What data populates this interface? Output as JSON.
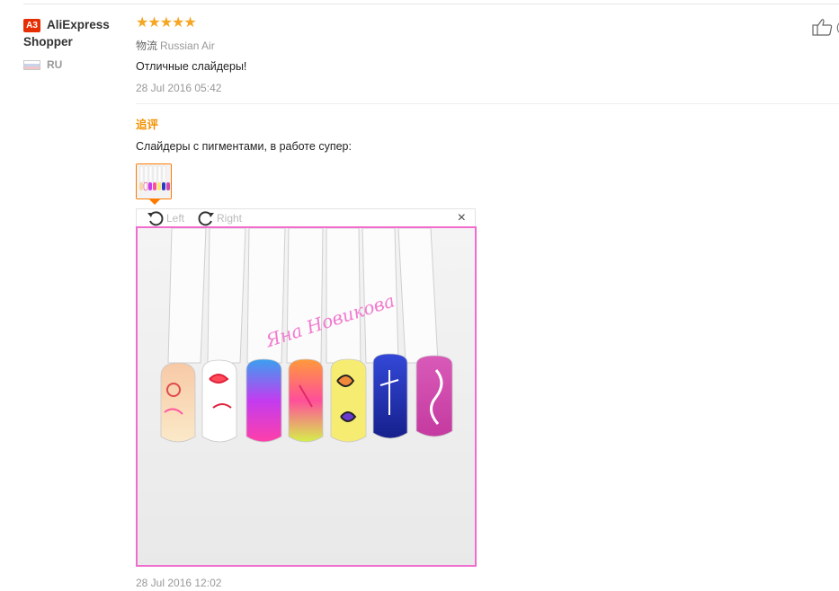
{
  "reviewer": {
    "badge": "A3",
    "name": "AliExpress Shopper",
    "country": "RU"
  },
  "review": {
    "stars": "★★★★★",
    "logistics_label": "物流",
    "logistics_value": "Russian Air",
    "text": "Отличные слайдеры!",
    "date": "28 Jul 2016 05:42",
    "like_count": "(",
    "followup_label": "追评",
    "followup_text": "Слайдеры с пигментами, в работе супер:",
    "followup_date": "28 Jul 2016 12:02"
  },
  "viewer": {
    "rotate_left": "Left",
    "rotate_right": "Right",
    "close": "×",
    "watermark": "Яна Новикова"
  },
  "colors": {
    "accent_orange": "#ff7a00",
    "star": "#f5a623",
    "followup": "#f29200",
    "photo_border": "#f06ccf",
    "badge": "#e62e04"
  }
}
